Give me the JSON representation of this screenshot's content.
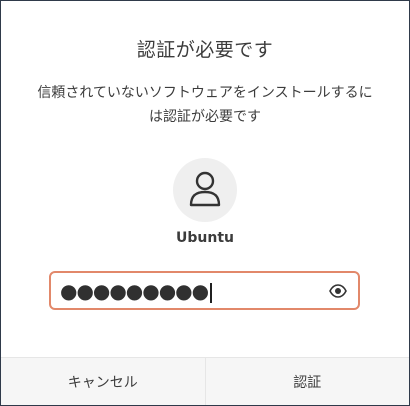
{
  "dialog": {
    "title": "認証が必要です",
    "message": "信頼されていないソフトウェアをインストールするには認証が必要です"
  },
  "user": {
    "avatar_icon": "user-icon",
    "name": "Ubuntu"
  },
  "password": {
    "value": "●●●●●●●●●",
    "visibility_icon": "eye-icon",
    "border_color": "#e2886a"
  },
  "buttons": {
    "cancel_label": "キャンセル",
    "authenticate_label": "認証"
  }
}
